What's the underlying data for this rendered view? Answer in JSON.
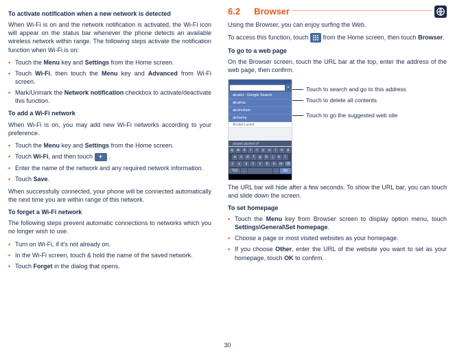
{
  "page_number": "30",
  "left": {
    "h1": "To activate notification when a new network is detected",
    "p1": "When Wi-Fi is on and the network notification is activated, the Wi-Fi icon will appear on the status bar whenever the phone detects an available wireless network within range. The following steps activate the notification function when Wi-Fi is on:",
    "b1a": "Touch the ",
    "b1b": "Menu",
    "b1c": " key and ",
    "b1d": "Settings",
    "b1e": " from the Home screen.",
    "b2a": "Touch ",
    "b2b": "Wi-Fi",
    "b2c": ", then touch the ",
    "b2d": "Menu",
    "b2e": " key and ",
    "b2f": "Advanced",
    "b2g": " from Wi-Fi screen.",
    "b3a": "Mark/Unmark the ",
    "b3b": "Network notification",
    "b3c": " checkbox to activate/deactivate this function.",
    "h2": "To add a Wi-Fi network",
    "p2": "When Wi-Fi is on, you may add new Wi-Fi networks according to your preference.",
    "b4a": "Touch the ",
    "b4b": "Menu",
    "b4c": " key and ",
    "b4d": "Settings",
    "b4e": " from the Home screen.",
    "b5a": "Touch ",
    "b5b": "Wi-Fi",
    "b5c": ", and then touch ",
    "b5d": " .",
    "b6": "Enter the name of the network and any required network information.",
    "b7a": "Touch ",
    "b7b": "Save",
    "b7c": ".",
    "p3": "When successfully connected, your phone will be connected automatically the next time you are within range of this network.",
    "h3": "To forget a Wi-Fi network",
    "p4": "The following steps prevent automatic connections to networks which you no longer wish to use.",
    "b8": "Turn on Wi-Fi, if it's not already on.",
    "b9": "In the Wi-Fi screen, touch & hold the name of the saved network.",
    "b10a": "Touch ",
    "b10b": "Forget",
    "b10c": " in the dialog that opens."
  },
  "right": {
    "chapter_num": "6.2",
    "chapter_title": "Browser",
    "p1": "Using the Browser, you can enjoy surfing the Web.",
    "p2a": "To access this function, touch ",
    "p2b": " from the Home screen, then touch ",
    "p2c": "Browser",
    "p2d": ".",
    "h1": "To go to a web page",
    "p3": "On the Browser screen, touch the URL bar at the top, enter the address of the web page, then confirm.",
    "callout1": "Touch to search and go to this address",
    "callout2": "Touch to delete all contents",
    "callout3": "Touch to go the suggested web site",
    "shot": {
      "s1": "alcatel - Google Search",
      "s2": "alcatraz",
      "s3": "alcoholism",
      "s4": "alchemy",
      "sub": "Alcatel-Lucent",
      "hint": "alcatel   alcohol   a? ",
      "k1": [
        "q",
        "w",
        "e",
        "r",
        "t",
        "y",
        "u",
        "i",
        "o",
        "p"
      ],
      "k2": [
        "a",
        "s",
        "d",
        "f",
        "g",
        "h",
        "j",
        "k",
        "l"
      ],
      "k3": [
        "⇧",
        "z",
        "x",
        "c",
        "v",
        "b",
        "n",
        "m",
        "⌫"
      ]
    },
    "p4": "The URL bar will hide after a few seconds. To show the URL bar, you can touch and slide down the screen.",
    "h2": "To set homepage",
    "b1a": "Touch the ",
    "b1b": "Menu",
    "b1c": " key from Browser screen to display option menu, touch ",
    "b1d": "Settings\\General\\Set homepage",
    "b1e": ".",
    "b2": "Choose a page or most visited websites as your homepage.",
    "b3a": "If you choose ",
    "b3b": "Other",
    "b3c": ", enter the URL of the website you want to set as your homepage, touch ",
    "b3d": "OK",
    "b3e": " to confirm."
  }
}
